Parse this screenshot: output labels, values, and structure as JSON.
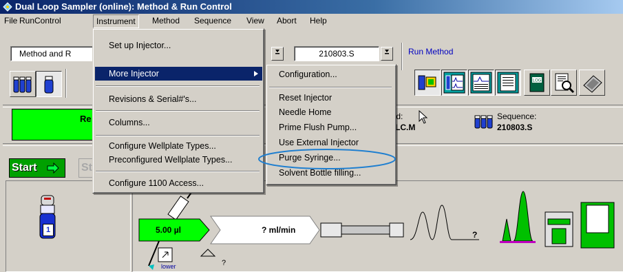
{
  "window": {
    "title": "Dual Loop Sampler (online): Method & Run Control"
  },
  "menubar": {
    "items": [
      "File",
      "RunControl",
      "Instrument",
      "Method",
      "Sequence",
      "View",
      "Abort",
      "Help"
    ]
  },
  "toolbar": {
    "view_combo": "Method and R",
    "file_combo": "210803.S",
    "run_method_label": "Run Method"
  },
  "status": {
    "ready_text": "Re",
    "method_label": "hod:",
    "method_value": "F_LC.M",
    "sequence_label": "Sequence:",
    "sequence_value": "210803.S"
  },
  "controls": {
    "start_label": "Start",
    "stop_label": "St"
  },
  "instrument_menu": {
    "items": [
      "Set up Injector...",
      "More Injector",
      "Revisions & Serial#'s...",
      "Columns...",
      "Configure Wellplate Types...",
      "Preconfigured Wellplate Types...",
      "Configure 1100 Access..."
    ]
  },
  "more_injector_submenu": {
    "items": [
      "Configuration...",
      "Reset Injector",
      "Needle Home",
      "Prime Flush Pump...",
      "Use External Injector",
      "Purge Syringe...",
      "Solvent Bottle filling..."
    ]
  },
  "diagram": {
    "vial_number": "1",
    "injection_volume": "5.00 µl",
    "flow_rate": "? ml/min",
    "detector_unknown": "?",
    "lower_label": "lower",
    "q_mark": "?"
  },
  "colors": {
    "status_green": "#00ff00",
    "highlight": "#0a246a",
    "annotation_ellipse": "#1f7fd0"
  }
}
